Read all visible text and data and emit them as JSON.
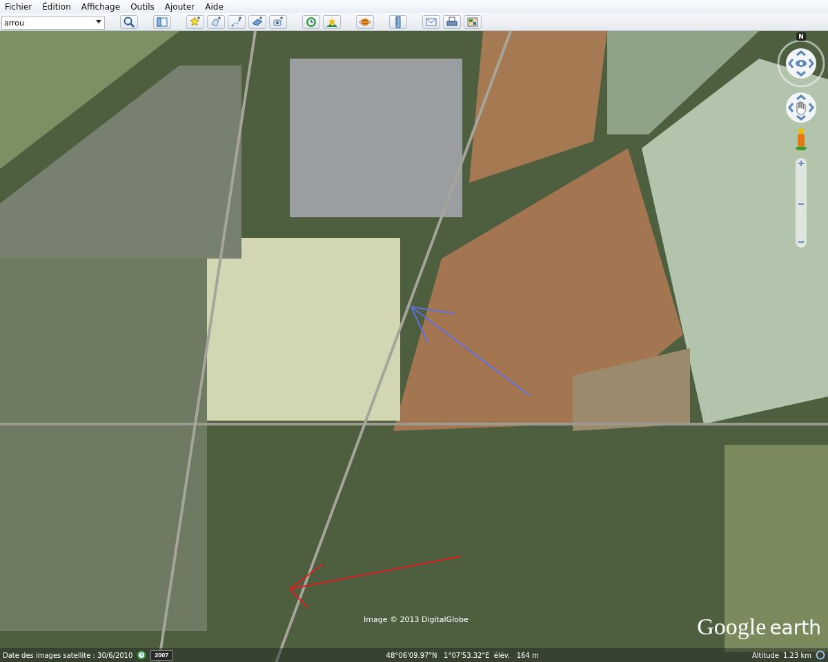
{
  "menu": [
    "Fichier",
    "Édition",
    "Affichage",
    "Outils",
    "Ajouter",
    "Aide"
  ],
  "search": {
    "value": "arrou"
  },
  "toolbar": [
    {
      "kind": "search"
    },
    {
      "kind": "sidebar"
    },
    {
      "kind": "placemark"
    },
    {
      "kind": "polygon"
    },
    {
      "kind": "path"
    },
    {
      "kind": "overlay"
    },
    {
      "kind": "tour"
    },
    {
      "kind": "history"
    },
    {
      "kind": "sun"
    },
    {
      "kind": "planet"
    },
    {
      "kind": "ruler"
    },
    {
      "kind": "email"
    },
    {
      "kind": "print"
    },
    {
      "kind": "map"
    }
  ],
  "compass": {
    "north": "N"
  },
  "zoom_slider": {
    "level": 0.5
  },
  "copyright": "Image © 2013 DigitalGlobe",
  "logo": {
    "brand": "Google",
    "product": "earth"
  },
  "status_bar": {
    "imagery_date": "Date des images satellite : 30/6/2010",
    "history_button": "2007",
    "coordinates": "48°06'09.97\"N   1°07'53.32\"E  élév.   164 m",
    "altitude_label": "Altitude",
    "altitude": "1.23 km"
  }
}
